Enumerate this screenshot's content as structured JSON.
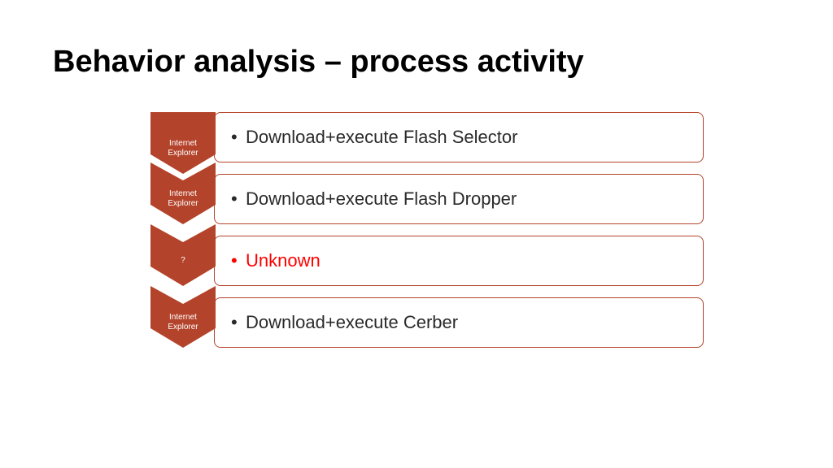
{
  "title": "Behavior analysis – process activity",
  "colors": {
    "chevron": "#b4432b",
    "border": "#b4432b",
    "highlight": "#ff0000"
  },
  "steps": [
    {
      "label": "Internet\nExplorer",
      "text": "Download+execute Flash Selector",
      "highlight": false
    },
    {
      "label": "Internet\nExplorer",
      "text": "Download+execute Flash Dropper",
      "highlight": false
    },
    {
      "label": "?",
      "text": "Unknown",
      "highlight": true
    },
    {
      "label": "Internet\nExplorer",
      "text": "Download+execute Cerber",
      "highlight": false
    }
  ]
}
